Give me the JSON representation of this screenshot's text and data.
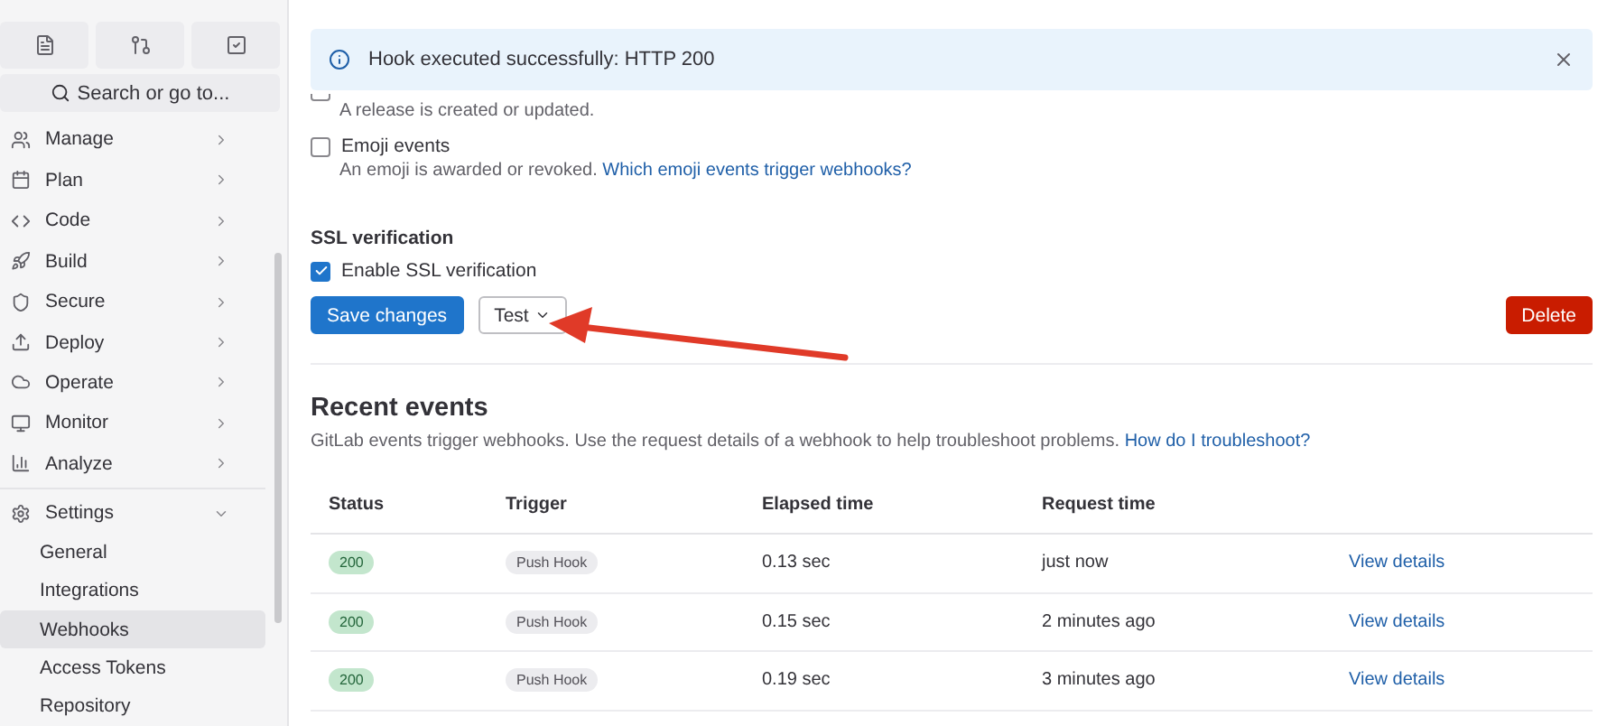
{
  "sidebar": {
    "search": {
      "placeholder": "Search or go to..."
    },
    "nav": [
      {
        "label": "Manage",
        "kind": "section",
        "expanded": false
      },
      {
        "label": "Plan",
        "kind": "section",
        "expanded": false
      },
      {
        "label": "Code",
        "kind": "section",
        "expanded": false
      },
      {
        "label": "Build",
        "kind": "section",
        "expanded": false
      },
      {
        "label": "Secure",
        "kind": "section",
        "expanded": false
      },
      {
        "label": "Deploy",
        "kind": "section",
        "expanded": false
      },
      {
        "label": "Operate",
        "kind": "section",
        "expanded": false
      },
      {
        "label": "Monitor",
        "kind": "section",
        "expanded": false
      },
      {
        "label": "Analyze",
        "kind": "section",
        "expanded": false
      },
      {
        "label": "Settings",
        "kind": "section",
        "expanded": true,
        "children": [
          {
            "label": "General",
            "selected": false
          },
          {
            "label": "Integrations",
            "selected": false
          },
          {
            "label": "Webhooks",
            "selected": true
          },
          {
            "label": "Access Tokens",
            "selected": false
          },
          {
            "label": "Repository",
            "selected": false
          }
        ]
      }
    ]
  },
  "alert": {
    "text": "Hook executed successfully: HTTP 200"
  },
  "events": [
    {
      "description": "A release is created or updated.",
      "checked": false
    },
    {
      "label": "Emoji events",
      "description": "An emoji is awarded or revoked.",
      "link": "Which emoji events trigger webhooks?",
      "checked": false
    }
  ],
  "ssl": {
    "heading": "SSL verification",
    "label": "Enable SSL verification",
    "checked": true
  },
  "buttons": {
    "save": "Save changes",
    "test": "Test",
    "delete": "Delete"
  },
  "recent": {
    "title": "Recent events",
    "description": "GitLab events trigger webhooks. Use the request details of a webhook to help troubleshoot problems.",
    "link": "How do I troubleshoot?"
  },
  "table": {
    "columns": [
      "Status",
      "Trigger",
      "Elapsed time",
      "Request time"
    ],
    "rows": [
      {
        "status": "200",
        "trigger": "Push Hook",
        "elapsed": "0.13 sec",
        "request_time": "just now",
        "action": "View details"
      },
      {
        "status": "200",
        "trigger": "Push Hook",
        "elapsed": "0.15 sec",
        "request_time": "2 minutes ago",
        "action": "View details"
      },
      {
        "status": "200",
        "trigger": "Push Hook",
        "elapsed": "0.19 sec",
        "request_time": "3 minutes ago",
        "action": "View details"
      }
    ]
  }
}
